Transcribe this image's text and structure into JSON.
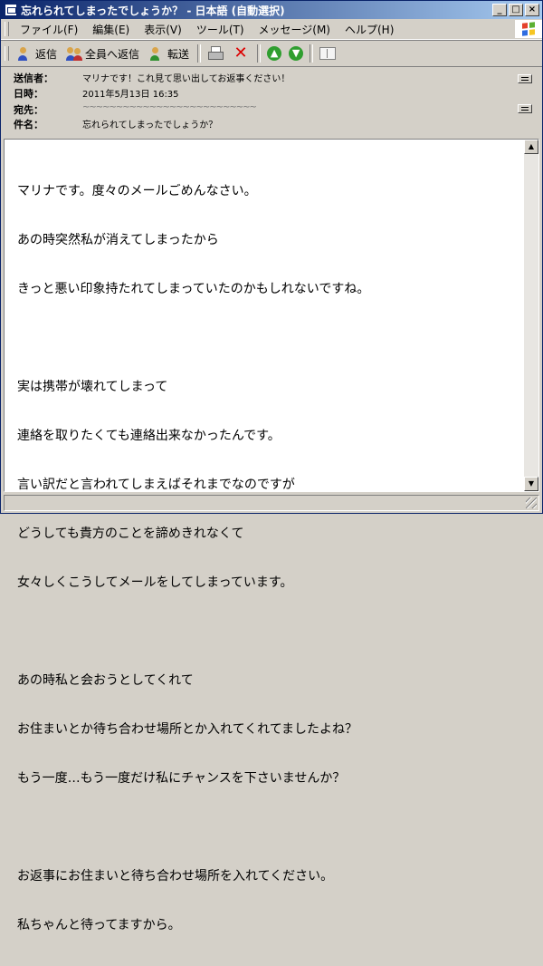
{
  "window": {
    "title": "忘れられてしまったでしょうか？ - 日本語 (自動選択)"
  },
  "title_buttons": [
    "_",
    "□",
    "×"
  ],
  "menu": [
    "ファイル(F)",
    "編集(E)",
    "表示(V)",
    "ツール(T)",
    "メッセージ(M)",
    "ヘルプ(H)"
  ],
  "toolbar": {
    "reply": "返信",
    "reply_all": "全員へ返信",
    "forward": "転送"
  },
  "header": {
    "from_label": "送信者：",
    "from_value": "マリナです！これ見て思い出してお返事ください！",
    "date_label": "日時：",
    "date_value": "2011年5月13日 16:35",
    "to_label": "宛先：",
    "to_value": "~~~~~~~~~~~~~~~~~~~~~~~~~~",
    "subject_label": "件名：",
    "subject_value": "忘れられてしまったでしょうか？"
  },
  "body": {
    "lines": [
      "マリナです。度々のメールごめんなさい。",
      "あの時突然私が消えてしまったから",
      "きっと悪い印象持たれてしまっていたのかもしれないですね。",
      "",
      "実は携帯が壊れてしまって",
      "連絡を取りたくても連絡出来なかったんです。",
      "言い訳だと言われてしまえばそれまでなのですが",
      "どうしても貴方のことを諦めきれなくて",
      "女々しくこうしてメールをしてしまっています。",
      "",
      "あの時私と会おうとしてくれて",
      "お住まいとか待ち合わせ場所とか入れてくれてましたよね？",
      "もう一度…もう一度だけ私にチャンスを下さいませんか？",
      "",
      "お返事にお住まいと待ち合わせ場所を入れてください。",
      "私ちゃんと待ってますから。"
    ]
  }
}
